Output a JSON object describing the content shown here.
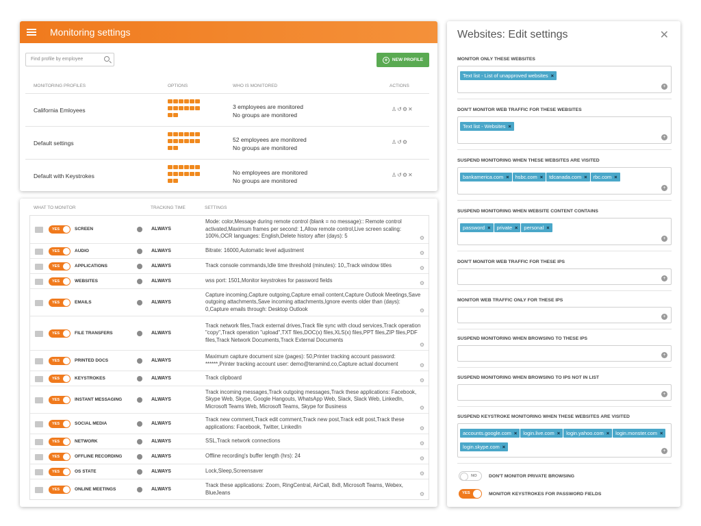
{
  "profiles_panel": {
    "title": "Monitoring settings",
    "search_placeholder": "Find profile by employee",
    "new_profile_label": "NEW PROFILE",
    "columns": [
      "MONITORING PROFILES",
      "OPTIONS",
      "WHO IS MONITORED",
      "ACTIONS"
    ],
    "rows": [
      {
        "name": "California Emloyees",
        "who1": "3 employees are monitored",
        "who2": "No groups are monitored"
      },
      {
        "name": "Default settings",
        "who1": "52 employees are monitored",
        "who2": "No groups are monitored"
      },
      {
        "name": "Default with Keystrokes",
        "who1": "No employees are monitored",
        "who2": "No groups are monitored"
      }
    ]
  },
  "monitor_panel": {
    "columns": [
      "WHAT TO MONITOR",
      "TRACKING TIME",
      "SETTINGS"
    ],
    "toggle_label": "YES",
    "rows": [
      {
        "label": "SCREEN",
        "time": "ALWAYS",
        "settings": "Mode: color,Message during remote control (blank = no message):: Remote control activated,Maximum frames per second: 1,Allow remote control,Live screen scaling: 100%,OCR languages: English,Delete history after (days): 5"
      },
      {
        "label": "AUDIO",
        "time": "ALWAYS",
        "settings": "Bitrate: 16000,Automatic level adjustment"
      },
      {
        "label": "APPLICATIONS",
        "time": "ALWAYS",
        "settings": "Track console commands,Idle time threshold (minutes): 10,,Track window titles"
      },
      {
        "label": "WEBSITES",
        "time": "ALWAYS",
        "settings": "wss port: 1501,Monitor keystrokes for password fields"
      },
      {
        "label": "EMAILS",
        "time": "ALWAYS",
        "settings": "Capture incoming,Capture outgoing,Capture email content,Capture Outlook Meetings,Save outgoing attachments,Save incoming attachments,Ignore events older than (days): 0,Capture emails through: Desktop Outlook"
      },
      {
        "label": "FILE TRANSFERS",
        "time": "ALWAYS",
        "settings": "Track network files,Track external drives,Track file sync with cloud services,Track operation \"copy\",Track operation \"upload\",TXT files,DOC(x) files,XLS(x) files,PPT files,ZIP files,PDF files,Track Network Documents,Track External Documents"
      },
      {
        "label": "PRINTED DOCS",
        "time": "ALWAYS",
        "settings": "Maximum capture document size (pages): 50,Printer tracking account password: ******,Printer tracking account user: demo@teramind.co,Capture actual document"
      },
      {
        "label": "KEYSTROKES",
        "time": "ALWAYS",
        "settings": "Track clipboard"
      },
      {
        "label": "INSTANT MESSAGING",
        "time": "ALWAYS",
        "settings": "Track incoming messages,Track outgoing messages,Track these applications: Facebook, Skype Web, Skype, Google Hangouts, WhatsApp Web, Slack, Slack Web, LinkedIn, Microsoft Teams Web, Microsoft Teams, Skype for Business"
      },
      {
        "label": "SOCIAL MEDIA",
        "time": "ALWAYS",
        "settings": "Track new comment,Track edit comment,Track new post,Track edit post,Track these applications: Facebook, Twitter, LinkedIn"
      },
      {
        "label": "NETWORK",
        "time": "ALWAYS",
        "settings": "SSL,Track network connections"
      },
      {
        "label": "OFFLINE RECORDING",
        "time": "ALWAYS",
        "settings": "Offline recording's buffer length (hrs): 24"
      },
      {
        "label": "OS STATE",
        "time": "ALWAYS",
        "settings": "Lock,Sleep,Screensaver"
      },
      {
        "label": "ONLINE MEETINGS",
        "time": "ALWAYS",
        "settings": "Track these applications: Zoom, RingCentral, AirCall, 8x8, Microsoft Teams, Webex, BlueJeans"
      }
    ]
  },
  "edit_panel": {
    "title": "Websites: Edit settings",
    "sections": [
      {
        "label": "MONITOR ONLY THESE WEBSITES",
        "chips": [
          "Text list - List of unapproved websites"
        ]
      },
      {
        "label": "DON'T MONITOR WEB TRAFFIC FOR THESE WEBSITES",
        "chips": [
          "Text list - Websites"
        ]
      },
      {
        "label": "SUSPEND MONITORING WHEN THESE WEBSITES ARE VISITED",
        "chips": [
          "bankamerica.com",
          "hsbc.com",
          "tdcanada.com",
          "rbc.com"
        ]
      },
      {
        "label": "SUSPEND MONITORING WHEN WEBSITE CONTENT CONTAINS",
        "chips": [
          "password",
          "private",
          "personal"
        ]
      },
      {
        "label": "DON'T MONITOR WEB TRAFFIC FOR THESE IPS",
        "chips": []
      },
      {
        "label": "MONITOR WEB TRAFFIC ONLY FOR THESE IPS",
        "chips": []
      },
      {
        "label": "SUSPEND MONITORING WHEN BROWSING TO THESE IPS",
        "chips": []
      },
      {
        "label": "SUSPEND MONITORING WHEN BROWSING TO IPS NOT IN LIST",
        "chips": []
      },
      {
        "label": "SUSPEND KEYSTROKE MONITORING WHEN THESE WEBSITES ARE VISITED",
        "chips": [
          "accounts.google.com",
          "login.live.com",
          "login.yahoo.com",
          "login.monster.com",
          "login.skype.com"
        ]
      }
    ],
    "toggles": [
      {
        "state": "NO",
        "label": "DON'T MONITOR PRIVATE BROWSING"
      },
      {
        "state": "YES",
        "label": "MONITOR KEYSTROKES FOR PASSWORD FIELDS"
      }
    ]
  },
  "colors": {
    "accent": "#f07a1d",
    "chip": "#4aa7c9",
    "new_profile": "#5aaa52"
  }
}
